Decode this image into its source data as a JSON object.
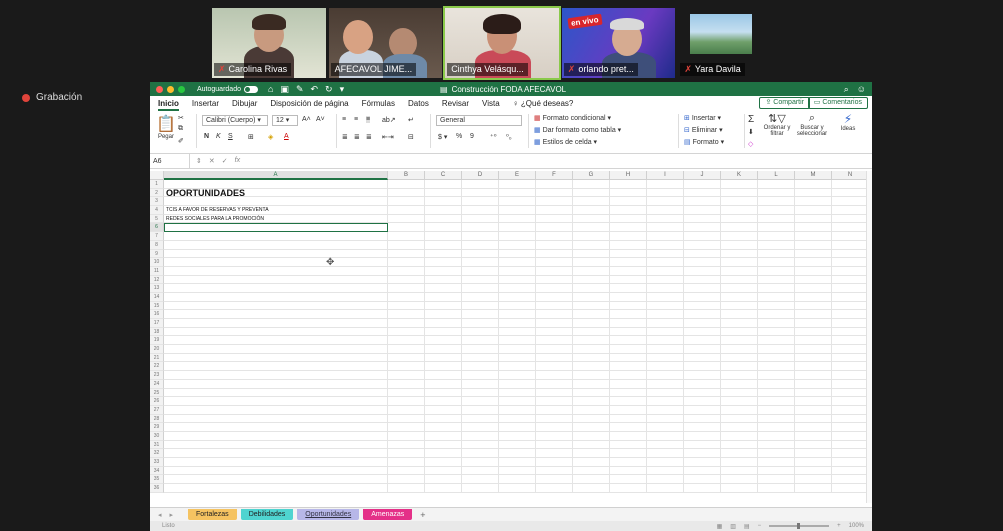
{
  "meeting": {
    "participants": [
      {
        "name": "Carolina Rivas",
        "muted": true
      },
      {
        "name": "AFECAVOL JIME...",
        "muted": false
      },
      {
        "name": "Cinthya Velásqu...",
        "muted": false
      },
      {
        "name": "orlando pret...",
        "muted": true,
        "badge": "en vivo"
      },
      {
        "name": "Yara Davila",
        "muted": true
      }
    ],
    "recording_label": "Grabación"
  },
  "excel": {
    "autosave_label": "Autoguardado",
    "document_title": "Construcción FODA AFECAVOL",
    "menu": [
      "Inicio",
      "Insertar",
      "Dibujar",
      "Disposición de página",
      "Fórmulas",
      "Datos",
      "Revisar",
      "Vista"
    ],
    "tell_me": "¿Qué deseas?",
    "share_label": "Compartir",
    "comments_label": "Comentarios",
    "ribbon": {
      "paste": "Pegar",
      "font_name": "Calibri (Cuerpo)",
      "font_size": "12",
      "number_format": "General",
      "cond_format": "Formato condicional",
      "format_table": "Dar formato como tabla",
      "cell_styles": "Estilos de celda",
      "insert": "Insertar",
      "delete": "Eliminar",
      "format": "Formato",
      "sort_filter": "Ordenar y filtrar",
      "find_select": "Buscar y seleccionar",
      "ideas": "Ideas"
    },
    "name_box": "A6",
    "columns": [
      "A",
      "B",
      "C",
      "D",
      "E",
      "F",
      "G",
      "H",
      "I",
      "J",
      "K",
      "L",
      "M",
      "N"
    ],
    "cells": {
      "A2": "OPORTUNIDADES",
      "A4": "TCIS A FAVOR DE RESERVAS Y PREVENTA",
      "A5": "REDES SOCIALES PARA LA PROMOCIÓN"
    },
    "active_cell": "A6",
    "row_count": 36,
    "sheets": [
      "Fortalezas",
      "Debilidades",
      "Oportunidades",
      "Amenazas"
    ],
    "active_sheet": "Oportunidades",
    "status_left": "Listo",
    "zoom": "100%"
  }
}
